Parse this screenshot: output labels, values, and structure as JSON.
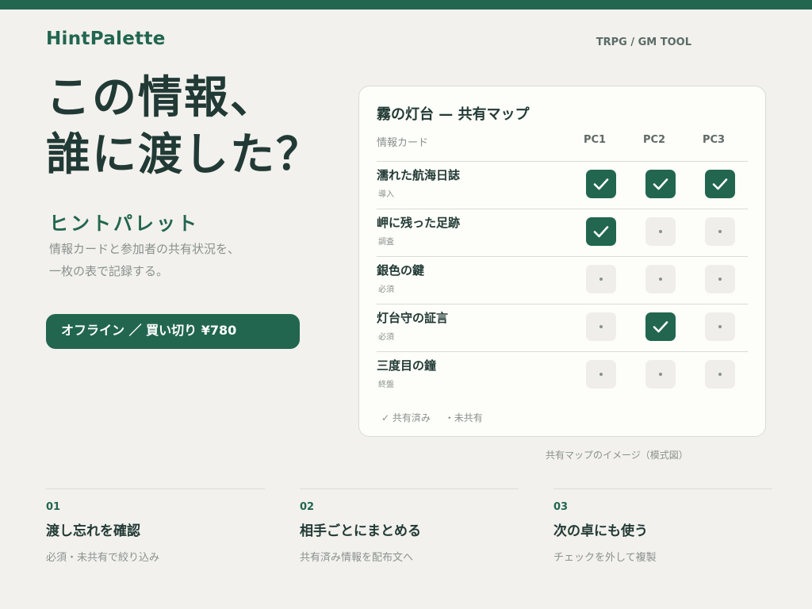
{
  "brand": {
    "logo": "HintPalette",
    "tagline": "TRPG / GM TOOL",
    "accent_color": "#226650"
  },
  "hero": {
    "title_line1": "この情報、",
    "title_line2": "誰に渡した？",
    "subtitle": "ヒントパレット",
    "desc_line1": "情報カードと参加者の共有状況を、",
    "desc_line2": "一枚の表で記録する。",
    "cta_label": "オフライン ／ 買い切り ¥780"
  },
  "map": {
    "title": "霧の灯台 — 共有マップ",
    "column_label": "情報カード",
    "players": [
      "PC1",
      "PC2",
      "PC3"
    ],
    "rows": [
      {
        "name": "濡れた航海日誌",
        "tag": "導入",
        "shared": [
          true,
          true,
          true
        ]
      },
      {
        "name": "岬に残った足跡",
        "tag": "調査",
        "shared": [
          true,
          false,
          false
        ]
      },
      {
        "name": "銀色の鍵",
        "tag": "必須",
        "shared": [
          false,
          false,
          false
        ]
      },
      {
        "name": "灯台守の証言",
        "tag": "必須",
        "shared": [
          false,
          true,
          false
        ]
      },
      {
        "name": "三度目の鐘",
        "tag": "終盤",
        "shared": [
          false,
          false,
          false
        ]
      }
    ],
    "legend_shared": "✓ 共有済み",
    "legend_unshared": "・未共有",
    "caption": "共有マップのイメージ（模式図）"
  },
  "features": [
    {
      "num": "01",
      "title": "渡し忘れを確認",
      "desc": "必須・未共有で絞り込み"
    },
    {
      "num": "02",
      "title": "相手ごとにまとめる",
      "desc": "共有済み情報を配布文へ"
    },
    {
      "num": "03",
      "title": "次の卓にも使う",
      "desc": "チェックを外して複製"
    }
  ]
}
